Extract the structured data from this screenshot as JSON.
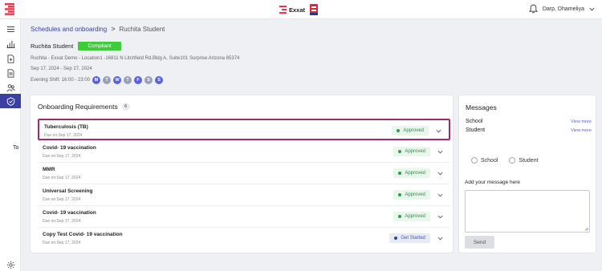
{
  "header": {
    "brand_name": "Exxat",
    "user_name": "Darp, Dhameliya"
  },
  "breadcrumb": {
    "parent": "Schedules and onboarding",
    "separator": ">",
    "current": "Ruchita Student"
  },
  "student": {
    "name": "Ruchita Student",
    "status_badge": "Compliant",
    "address": "Ruchita - Exxat Demo - Location1 -16811 N Litchfield Rd,Bldg A, Suite101 Surprise Arizona 85374",
    "date_range": "Sep 17, 2024 - Sep 27, 2024",
    "shift": "Evening Shift: 16:00 - 23:00",
    "days": [
      {
        "letter": "M",
        "active": true
      },
      {
        "letter": "T",
        "active": false
      },
      {
        "letter": "W",
        "active": true
      },
      {
        "letter": "T",
        "active": false
      },
      {
        "letter": "F",
        "active": true
      },
      {
        "letter": "S",
        "active": false
      },
      {
        "letter": "S",
        "active": true
      }
    ]
  },
  "onboarding": {
    "title": "Onboarding Requirements",
    "count": "6",
    "items": [
      {
        "name": "Tuberculosis (TB)",
        "due": "Due on:Sep 17, 2024",
        "status": "Approved"
      },
      {
        "name": "Covid- 19 vaccination",
        "due": "Due on:Sep 17, 2024",
        "status": "Approved"
      },
      {
        "name": "MMR",
        "due": "Due on:Sep 17, 2024",
        "status": "Approved"
      },
      {
        "name": "Universal Screening",
        "due": "Due on:Sep 17, 2024",
        "status": "Approved"
      },
      {
        "name": "Covid- 19 vaccination",
        "due": "Due on:Sep 17, 2024",
        "status": "Approved"
      },
      {
        "name": "Copy Test Covid- 19 vaccination",
        "due": "Due on:Sep 17, 2024",
        "status": "Get Started"
      }
    ]
  },
  "messages": {
    "title": "Messages",
    "rows": [
      {
        "label": "School",
        "action": "View more"
      },
      {
        "label": "Student",
        "action": "View more"
      }
    ],
    "to_label": "To",
    "options": [
      "School",
      "Student"
    ],
    "add_label": "Add your message here",
    "send_label": "Send"
  },
  "colors": {
    "accent": "#3b3f9e",
    "compliant": "#3fcc3a",
    "selection": "#a3286e",
    "approved": "#2f8f48"
  }
}
